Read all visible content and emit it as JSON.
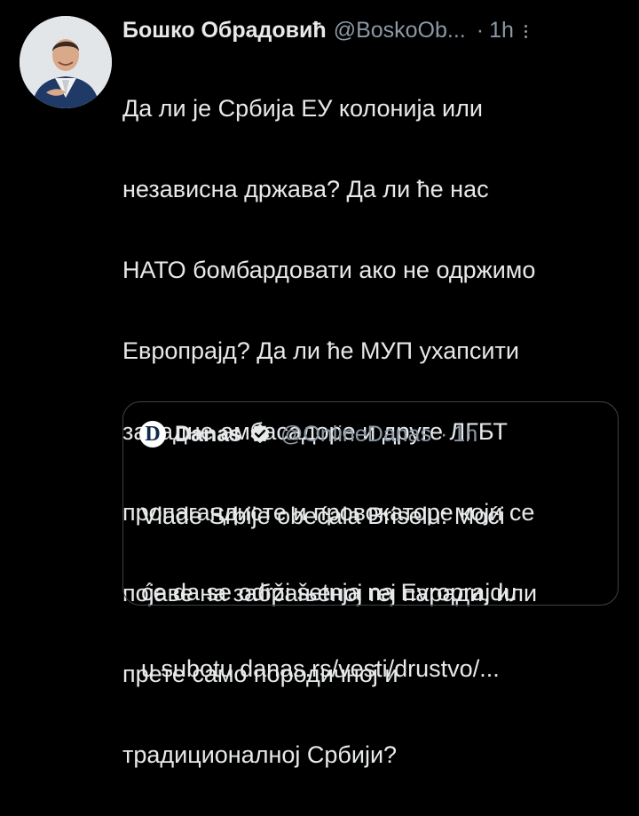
{
  "tweet": {
    "author_name": "Бошко Обрадовић",
    "author_handle": "@BoskoOb...",
    "separator": "·",
    "time": "1h",
    "text_lines": [
      "Да ли је Србија ЕУ колонија или",
      "независна држава? Да ли ће нас",
      "НАТО бомбардовати ако не одржимо",
      "Европрајд? Да ли ће МУП ухапсити",
      "западне амбасадоре и друге ЛГБТ",
      "пропагандисте и провокаторе који се",
      "појаве на забрањеној геј паради, или",
      "прете само породичној и",
      "традиционалној Србији?"
    ]
  },
  "quote": {
    "logo_letter": "D",
    "author_name": "Danas",
    "author_handle": "@OnlineDanas",
    "separator": "·",
    "time": "1h",
    "text_lines": [
      "Vlade Srbije obećala Briselu: Moći",
      "će da se održi šetnja na Evroprajdu",
      "u subotu danas.rs/vesti/drustvo/..."
    ]
  },
  "icons": {
    "more": "more-vertical-icon",
    "verified": "verified-badge-icon"
  },
  "colors": {
    "background": "#000000",
    "text_primary": "#e7e9ea",
    "text_secondary": "#8b98a5",
    "border": "#3e4144"
  }
}
